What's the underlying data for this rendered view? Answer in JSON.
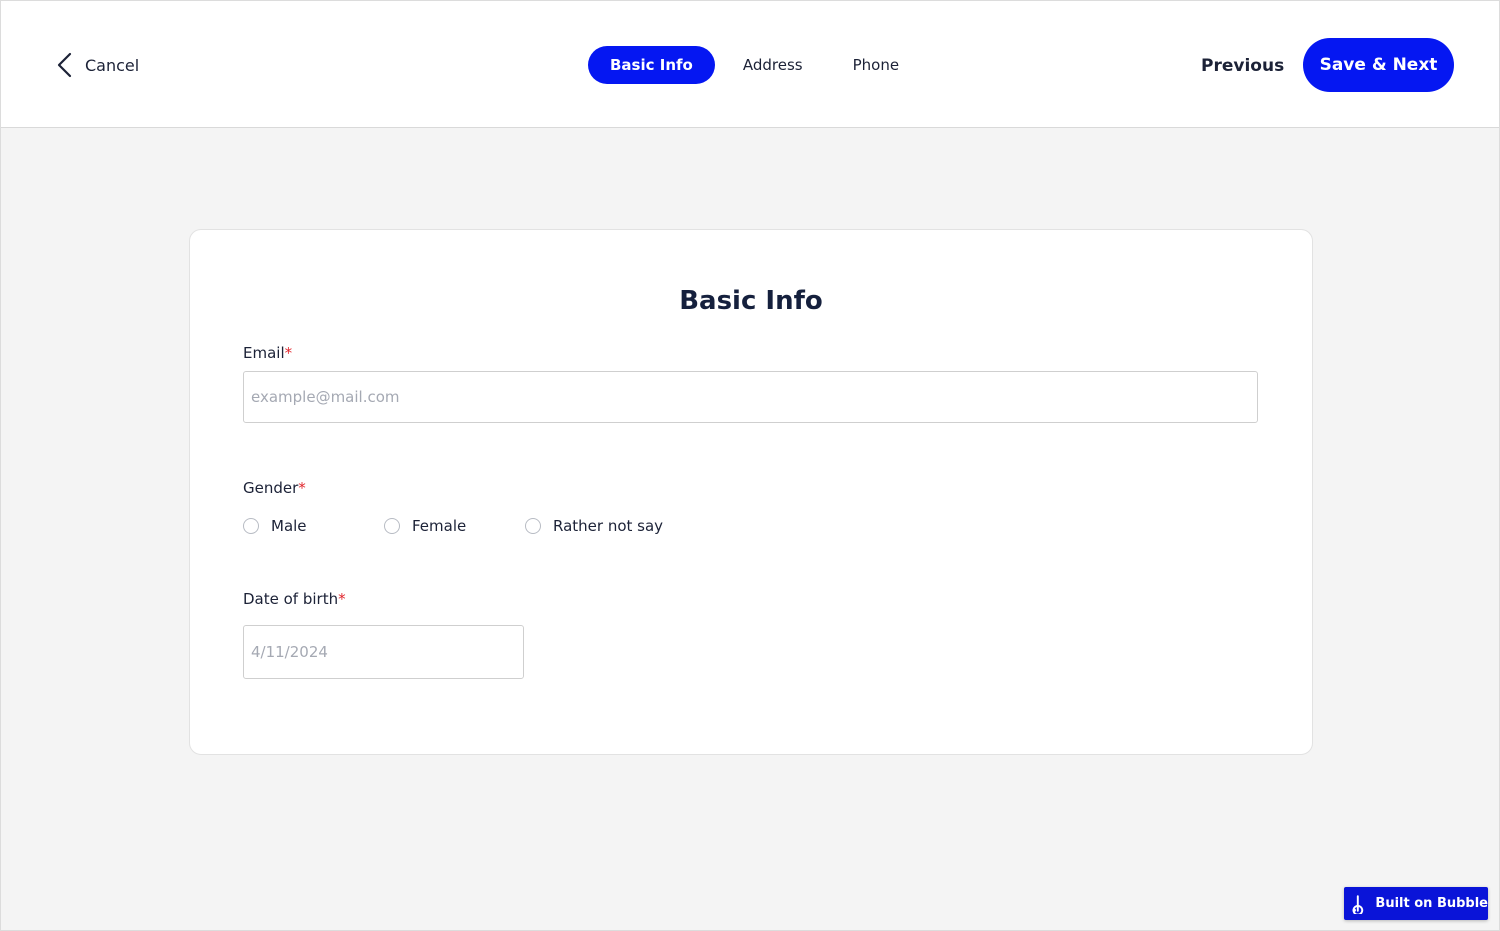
{
  "header": {
    "cancel_label": "Cancel",
    "tabs": [
      {
        "label": "Basic Info",
        "active": true
      },
      {
        "label": "Address",
        "active": false
      },
      {
        "label": "Phone",
        "active": false
      }
    ],
    "previous_label": "Previous",
    "save_next_label": "Save & Next"
  },
  "form": {
    "title": "Basic Info",
    "required_marker": "*",
    "email": {
      "label": "Email",
      "value": "",
      "placeholder": "example@mail.com"
    },
    "gender": {
      "label": "Gender",
      "options": [
        "Male",
        "Female",
        "Rather not say"
      ],
      "selected": null
    },
    "dob": {
      "label": "Date of birth",
      "value": "",
      "placeholder": "4/11/2024"
    }
  },
  "badge": {
    "label": "Built on Bubble"
  },
  "colors": {
    "accent": "#0517f2",
    "text": "#1c2237",
    "required": "#e0262d",
    "page_bg": "#f4f4f4"
  },
  "icons": {
    "cancel": "chevron-left-icon",
    "badge": "bubble-logo-icon"
  }
}
